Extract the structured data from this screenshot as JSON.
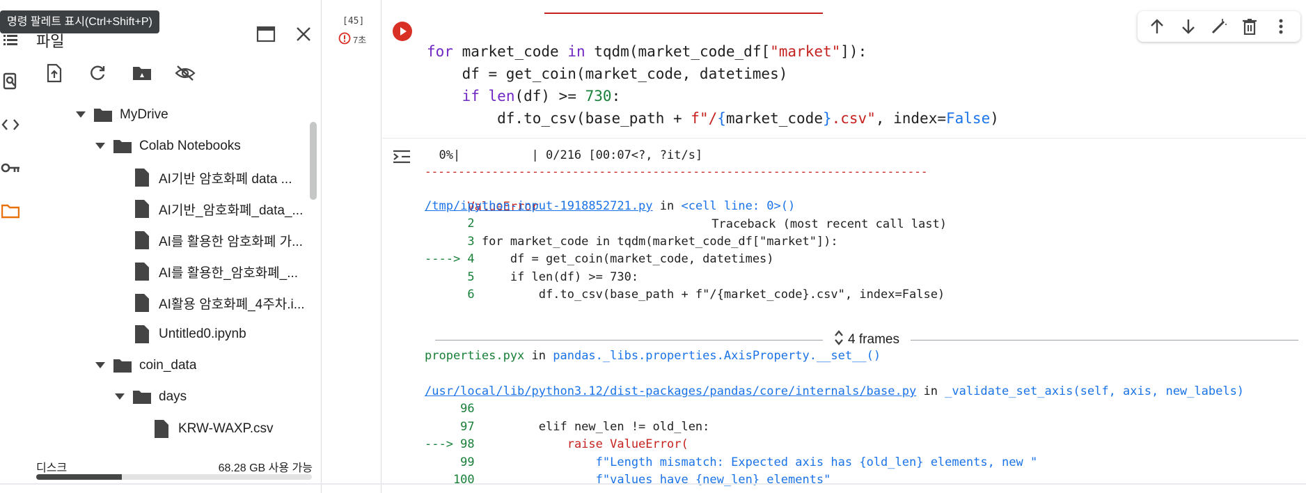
{
  "tooltip": "명령 팔레트 표시(Ctrl+Shift+P)",
  "rail": {
    "icons": [
      "toc-icon",
      "find-replace-icon",
      "code-snippets-icon",
      "key-icon",
      "folder-icon"
    ]
  },
  "files": {
    "title": "파일",
    "tree": [
      {
        "label": "MyDrive",
        "type": "folder",
        "expanded": true
      },
      {
        "label": "Colab Notebooks",
        "type": "folder",
        "expanded": true
      },
      {
        "label": "AI기반 암호화폐 data ...",
        "type": "file"
      },
      {
        "label": "AI기반_암호화폐_data_...",
        "type": "file"
      },
      {
        "label": "AI를 활용한 암호화폐 가...",
        "type": "file"
      },
      {
        "label": "AI를 활용한_암호화폐_...",
        "type": "file"
      },
      {
        "label": "AI활용 암호화폐_4주차.i...",
        "type": "file"
      },
      {
        "label": "Untitled0.ipynb",
        "type": "file"
      },
      {
        "label": "coin_data",
        "type": "folder",
        "expanded": true
      },
      {
        "label": "days",
        "type": "folder",
        "expanded": true
      },
      {
        "label": "KRW-WAXP.csv",
        "type": "file"
      }
    ],
    "disk_label": "디스크",
    "disk_free": "68.28 GB 사용 가능",
    "disk_used_fraction": 0.31
  },
  "cell": {
    "exec_count": "[45]",
    "exec_time": "7초",
    "code_lines": [
      "for market_code in tqdm(market_code_df[\"market\"]):",
      "    df = get_coin(market_code, datetimes)",
      "    if len(df) >= 730:",
      "        df.to_csv(base_path + f\"/{market_code}.csv\", index=False)"
    ]
  },
  "output": {
    "progress": "  0%|          | 0/216 [00:07<?, ?it/s]",
    "divider": "---------------------------------------------------------------------------",
    "error_name": "ValueError",
    "traceback_label": "Traceback (most recent call last)",
    "frame1_file": "/tmp/ipython-input-1918852721.py",
    "in_word": " in ",
    "frame1_ctx": "<cell line: 0>()",
    "frame1_lines": [
      {
        "no": "      2",
        "code": ""
      },
      {
        "no": "      3",
        "code": " for market_code in tqdm(market_code_df[\"market\"]):"
      },
      {
        "no": "----> 4",
        "code": "     df = get_coin(market_code, datetimes)"
      },
      {
        "no": "      5",
        "code": "     if len(df) >= 730:"
      },
      {
        "no": "      6",
        "code": "         df.to_csv(base_path + f\"/{market_code}.csv\", index=False)"
      }
    ],
    "frames_label": "4 frames",
    "frame2_file": "properties.pyx",
    "frame2_ctx": "pandas._libs.properties.AxisProperty.__set__()",
    "frame3_file": "/usr/local/lib/python3.12/dist-packages/pandas/core/internals/base.py",
    "frame3_ctx": "_validate_set_axis(self, axis, new_labels)",
    "frame3_lines": [
      {
        "no": "     96",
        "code": ""
      },
      {
        "no": "     97",
        "code": "         elif new_len != old_len:"
      },
      {
        "no": "---> 98",
        "code": "             raise ValueError("
      },
      {
        "no": "     99",
        "code": "                 f\"Length mismatch: Expected axis has {old_len} elements, new \""
      },
      {
        "no": "    100",
        "code": "                 f\"values have {new_len} elements\""
      }
    ]
  },
  "colors": {
    "accent": "#1a73e8",
    "error": "#c5221f",
    "run": "#d93025",
    "folder_icon": "#e8710a"
  }
}
